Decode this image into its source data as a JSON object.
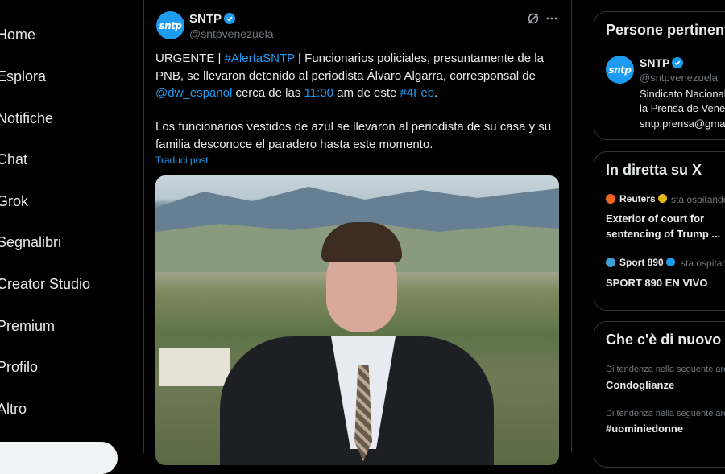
{
  "nav": {
    "items": [
      {
        "label": "Home"
      },
      {
        "label": "Esplora"
      },
      {
        "label": "Notifiche"
      },
      {
        "label": "Chat"
      },
      {
        "label": "Grok"
      },
      {
        "label": "Segnalibri"
      },
      {
        "label": "Creator Studio"
      },
      {
        "label": "Premium"
      },
      {
        "label": "Profilo"
      },
      {
        "label": "Altro"
      }
    ]
  },
  "tweet": {
    "author_name": "SNTP",
    "author_handle": "@sntpvenezuela",
    "avatar_text": "sntp",
    "p1_a": "URGENTE | ",
    "p1_hashtag1": "#AlertaSNTP",
    "p1_b": " | Funcionarios policiales, presuntamente de la PNB, se llevaron detenido al periodista Álvaro Algarra, corresponsal de ",
    "p1_mention": "@dw_espanol",
    "p1_c": " cerca de las ",
    "p1_time": "11:00",
    "p1_d": " am de este ",
    "p1_hashtag2": "#4Feb",
    "p1_e": ".",
    "p2": "Los funcionarios vestidos de azul se llevaron al periodista de su casa y su familia desconoce el paradero hasta este momento.",
    "translate": "Traduci post"
  },
  "relevant": {
    "title": "Persone pertinenti",
    "name": "SNTP",
    "handle": "@sntpvenezuela",
    "bio_1": "Sindicato Nacional",
    "bio_2": "la Prensa de Venezuela",
    "bio_3": "sntp.prensa@gmail"
  },
  "live": {
    "title": "In diretta su X",
    "items": [
      {
        "source": "Reuters",
        "status": "sta ospitando",
        "line1": "Exterior of court for",
        "line2": "sentencing of Trump ..."
      },
      {
        "source": "Sport 890",
        "status": "sta ospitando",
        "line1": "SPORT 890 EN VIVO"
      }
    ]
  },
  "trends": {
    "title": "Che c'è di nuovo",
    "items": [
      {
        "context": "Di tendenza nella seguente area",
        "name": "Condoglianze"
      },
      {
        "context": "Di tendenza nella seguente area",
        "name": "#uominiedonne"
      }
    ]
  },
  "colors": {
    "accent": "#1d9bf0",
    "background": "#000000",
    "text": "#e7e9ea",
    "muted": "#71767b"
  }
}
